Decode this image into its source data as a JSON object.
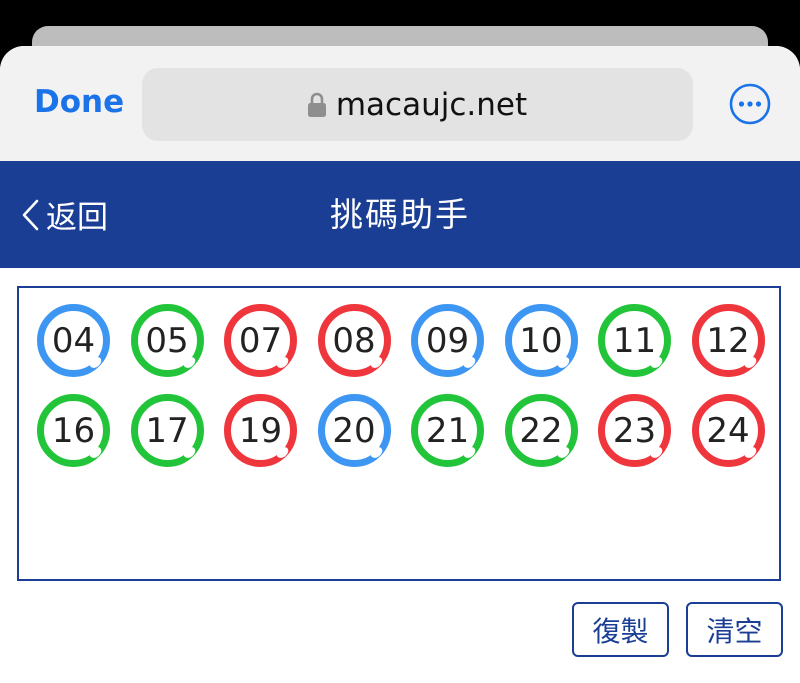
{
  "browser": {
    "done_label": "Done",
    "url": "macaujc.net"
  },
  "header": {
    "back_label": "返回",
    "title": "挑碼助手"
  },
  "balls": [
    {
      "number": "04",
      "color": "#3d97f2"
    },
    {
      "number": "05",
      "color": "#22c53a"
    },
    {
      "number": "07",
      "color": "#f0363d"
    },
    {
      "number": "08",
      "color": "#f0363d"
    },
    {
      "number": "09",
      "color": "#3d97f2"
    },
    {
      "number": "10",
      "color": "#3d97f2"
    },
    {
      "number": "11",
      "color": "#22c53a"
    },
    {
      "number": "12",
      "color": "#f0363d"
    },
    {
      "number": "16",
      "color": "#22c53a"
    },
    {
      "number": "17",
      "color": "#22c53a"
    },
    {
      "number": "19",
      "color": "#f0363d"
    },
    {
      "number": "20",
      "color": "#3d97f2"
    },
    {
      "number": "21",
      "color": "#22c53a"
    },
    {
      "number": "22",
      "color": "#22c53a"
    },
    {
      "number": "23",
      "color": "#f0363d"
    },
    {
      "number": "24",
      "color": "#f0363d"
    }
  ],
  "actions": {
    "copy_label": "復製",
    "clear_label": "清空"
  },
  "colors": {
    "header_bg": "#1a3e94",
    "link_blue": "#1a73e8"
  },
  "icons": {
    "lock": "lock-icon",
    "more": "more-icon",
    "back": "chevron-left-icon"
  }
}
